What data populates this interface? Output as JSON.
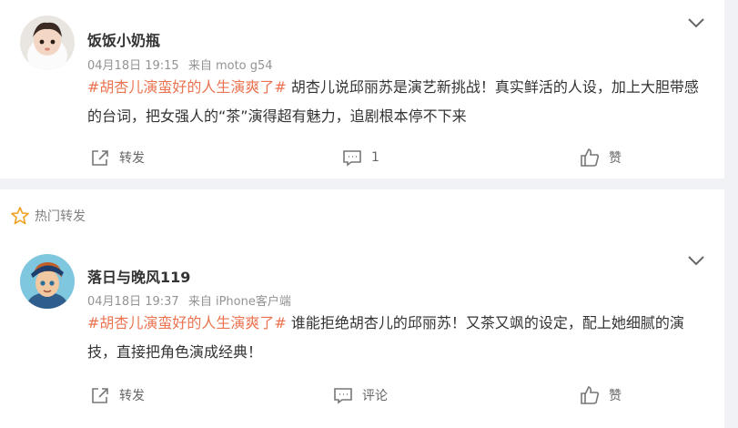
{
  "posts": [
    {
      "username": "饭饭小奶瓶",
      "time": "04月18日 19:15",
      "source": "来自 moto g54",
      "topic": "#胡杏儿演蛮好的人生演爽了#",
      "text": " 胡杏儿说邱丽苏是演艺新挑战！真实鲜活的人设，加上大胆带感的台词，把女强人的“茶”演得超有魅力，追剧根本停不下来",
      "repost_label": "转发",
      "comment_label": "1",
      "like_label": "赞"
    },
    {
      "username": "落日与晚风119",
      "time": "04月18日 19:37",
      "source": "来自 iPhone客户端",
      "topic": "#胡杏儿演蛮好的人生演爽了#",
      "text": " 谁能拒绝胡杏儿的邱丽苏！又茶又飒的设定，配上她细腻的演技，直接把角色演成经典！",
      "repost_label": "转发",
      "comment_label": "评论",
      "like_label": "赞"
    }
  ],
  "section": {
    "hot_reposts_label": "热门转发"
  },
  "colors": {
    "topic": "#eb7350",
    "meta": "#939393",
    "background": "#f1f2f5"
  }
}
